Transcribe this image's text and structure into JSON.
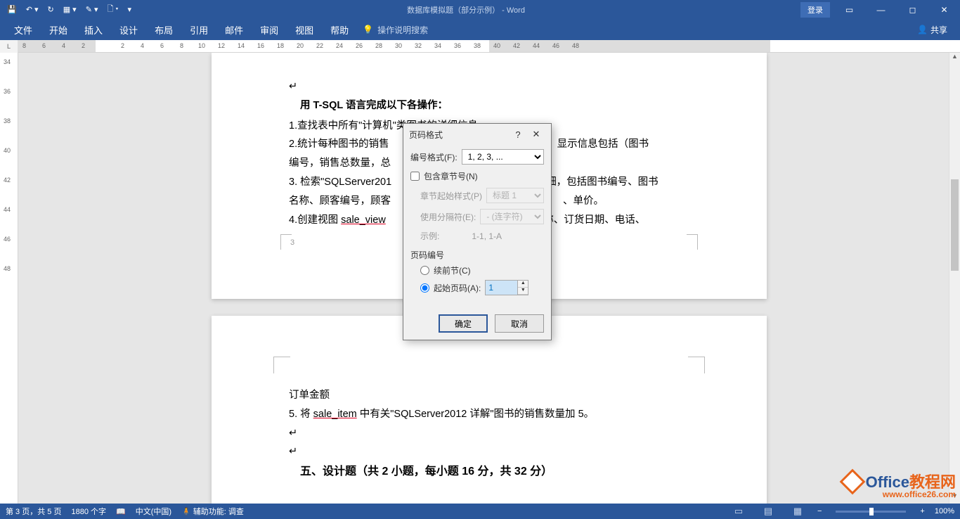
{
  "titlebar": {
    "doc_title": "数据库模拟题（部分示例） - Word",
    "login": "登录"
  },
  "ribbon": {
    "tabs": [
      "文件",
      "开始",
      "插入",
      "设计",
      "布局",
      "引用",
      "邮件",
      "审阅",
      "视图",
      "帮助"
    ],
    "tellme": "操作说明搜索",
    "share": "共享"
  },
  "ruler": {
    "h_left": [
      "8",
      "6",
      "4",
      "2"
    ],
    "h_right": [
      "2",
      "4",
      "6",
      "8",
      "10",
      "12",
      "14",
      "16",
      "18",
      "20",
      "22",
      "24",
      "26",
      "28",
      "30",
      "32",
      "34",
      "36",
      "38",
      "40",
      "42",
      "44",
      "46",
      "48"
    ],
    "v": [
      "34",
      "36",
      "38",
      "40",
      "42",
      "44",
      "46",
      "48"
    ]
  },
  "doc": {
    "heading": "用 T-SQL 语言完成以下各操作：",
    "p1_a": "1.查找表中所有\"计算机\"类图书的详细信息。",
    "p2_a": "2.统计每种图书的销售",
    "p2_b": "价，显示信息包括（图书",
    "p3": "编号，销售总数量，总",
    "p4_a": "3. 检索\"SQLServer201",
    "p4_b": "细，包括图书编号、图书",
    "p5": "名称、顾客编号，顾客",
    "p5_b": "、单价。",
    "p6_a": "4.创建视图 ",
    "p6_u": "sale_view",
    "p6_b": "名称、订货日期、电话、",
    "pagenum_small": "3",
    "p7": "订单金额",
    "p8_a": "5. 将 ",
    "p8_u": "sale_item",
    "p8_b": " 中有关\"SQLServer2012 详解\"图书的销售数量加 5。",
    "heading2": "五、设计题（共 2 小题，每小题 16 分，共 32 分）"
  },
  "dialog": {
    "title": "页码格式",
    "format_label": "编号格式(F):",
    "format_value": "1, 2, 3, ...",
    "include_chapter": "包含章节号(N)",
    "chapter_style_label": "章节起始样式(P)",
    "chapter_style_value": "标题 1",
    "separator_label": "使用分隔符(E):",
    "separator_value": "- (连字符)",
    "example_label": "示例:",
    "example_value": "1-1, 1-A",
    "pagenum_section": "页码编号",
    "continue_label": "续前节(C)",
    "startat_label": "起始页码(A):",
    "startat_value": "1",
    "ok": "确定",
    "cancel": "取消"
  },
  "statusbar": {
    "page": "第 3 页，共 5 页",
    "words": "1880 个字",
    "lang": "中文(中国)",
    "a11y": "辅助功能: 调查",
    "zoom": "100%"
  },
  "watermark": {
    "text1": "Office",
    "text2": "教程网",
    "url": "www.office26.com"
  }
}
